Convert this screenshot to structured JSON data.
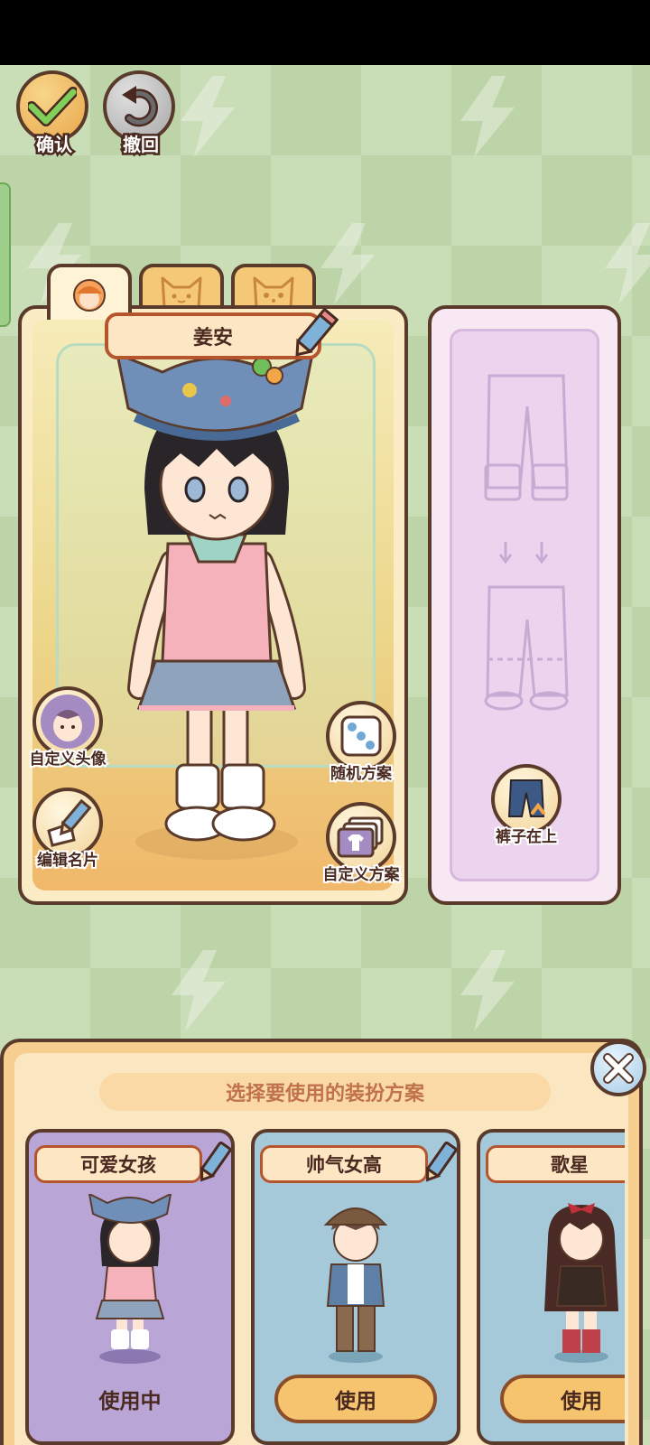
{
  "top_buttons": {
    "confirm": "确认",
    "undo": "撤回"
  },
  "tabs": [
    "human-face",
    "cat-face-1",
    "cat-face-2"
  ],
  "character": {
    "name": "姜安"
  },
  "side_buttons": {
    "custom_avatar": "自定义头像",
    "edit_card": "编辑名片",
    "random_outfit": "随机方案",
    "custom_outfit": "自定义方案"
  },
  "pants_panel": {
    "toggle_label": "裤子在上"
  },
  "sheet": {
    "title": "选择要使用的装扮方案",
    "cards": [
      {
        "name": "可爱女孩",
        "action": "使用中",
        "state": "active"
      },
      {
        "name": "帅气女高",
        "action": "使用",
        "state": "idle"
      },
      {
        "name": "歌星",
        "action": "使用",
        "state": "idle"
      }
    ]
  },
  "colors": {
    "background": "#c9ddb6",
    "panel_border": "#5a3a2a",
    "active_card": "#b9a6d6",
    "idle_card": "#a5c9d8",
    "use_button": "#f6c36e"
  }
}
